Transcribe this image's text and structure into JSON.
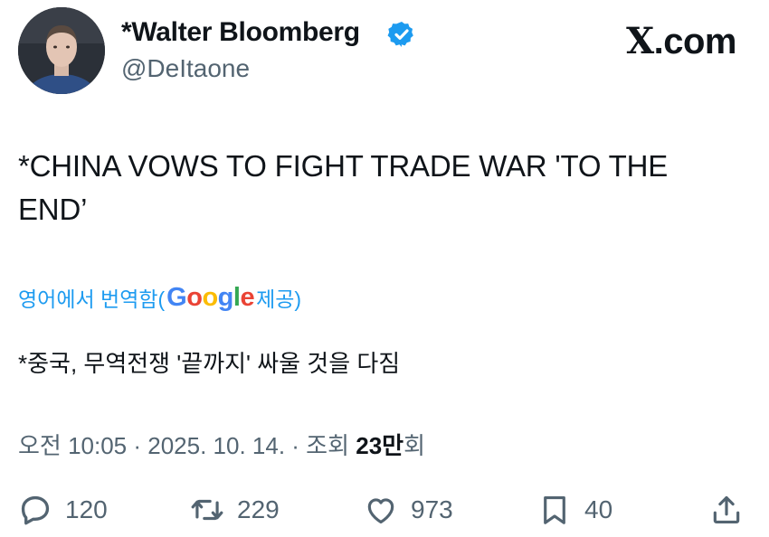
{
  "author": {
    "display_name": "*Walter Bloomberg",
    "handle": "@DeItaone",
    "verified": true
  },
  "source_brand": {
    "x_letter": "X",
    "suffix": ".com"
  },
  "tweet": {
    "text": "*CHINA VOWS TO FIGHT TRADE WAR 'TO THE END’"
  },
  "translation": {
    "prefix": "영어에서 번역함(",
    "google": [
      "G",
      "o",
      "o",
      "g",
      "l",
      "e"
    ],
    "suffix": " 제공)",
    "text": "*중국, 무역전쟁 '끝까지' 싸울 것을 다짐"
  },
  "meta": {
    "time": "오전 10:05",
    "sep1": " · ",
    "date": "2025. 10. 14.",
    "sep2": " · ",
    "views_label": "조회 ",
    "views_count": "23만",
    "views_suffix": "회"
  },
  "actions": {
    "reply_count": "120",
    "repost_count": "229",
    "like_count": "973",
    "bookmark_count": "40"
  },
  "colors": {
    "link_blue": "#1d9bf0",
    "muted": "#536471",
    "text": "#0f1419"
  },
  "icons": [
    "verified-badge-icon",
    "reply-icon",
    "repost-icon",
    "like-icon",
    "bookmark-icon",
    "share-icon"
  ]
}
